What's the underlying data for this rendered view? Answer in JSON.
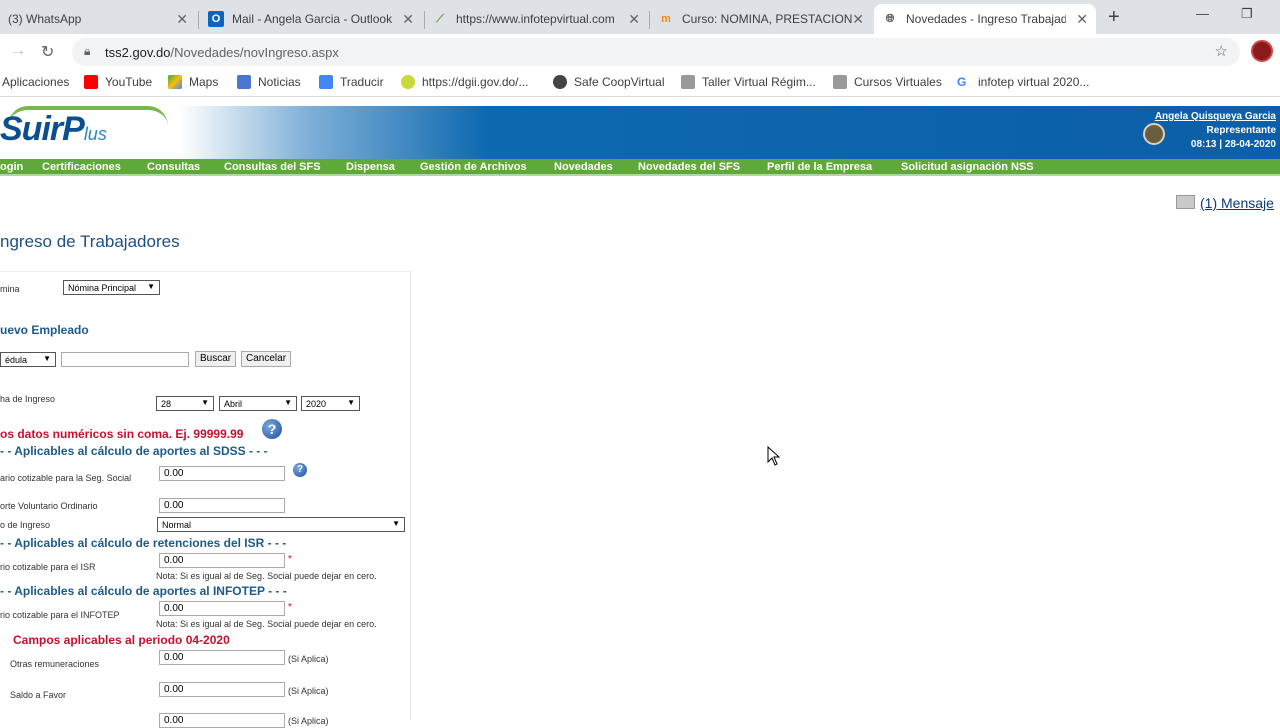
{
  "browser": {
    "tabs": [
      {
        "title": "(3) WhatsApp",
        "icon": "whatsapp-icon"
      },
      {
        "title": "Mail - Angela Garcia - Outlook",
        "icon": "outlook-icon"
      },
      {
        "title": "https://www.infotepvirtual.com",
        "icon": "infotep-icon"
      },
      {
        "title": "Curso: NOMINA, PRESTACIONE",
        "icon": "moodle-icon"
      },
      {
        "title": "Novedades - Ingreso Trabajad",
        "icon": "globe-icon"
      }
    ],
    "url_host": "tss2.gov.do",
    "url_path": "/Novedades/novIngreso.aspx",
    "bookmarks": [
      "Aplicaciones",
      "YouTube",
      "Maps",
      "Noticias",
      "Traducir",
      "https://dgii.gov.do/...",
      "Safe CoopVirtual",
      "Taller Virtual Régim...",
      "Cursos Virtuales",
      "infotep virtual 2020..."
    ]
  },
  "site": {
    "logo_main": "SuirP",
    "logo_tail": "lus",
    "user_name": "Angela Quisqueya Garcia",
    "user_role": "Representante",
    "user_time": "08:13 | 28-04-2020",
    "menu": [
      "ogin",
      "Certificaciones",
      "Consultas",
      "Consultas del SFS",
      "Dispensa",
      "Gestión de Archivos",
      "Novedades",
      "Novedades del SFS",
      "Perfil de la Empresa",
      "Solicitud asignación NSS"
    ],
    "messages_link": "(1) Mensaje"
  },
  "page": {
    "title": "ngreso de Trabajadores",
    "nomina_label": "mina",
    "nomina_value": "Nómina Principal",
    "new_employee_title": "uevo Empleado",
    "doc_type_value": "édula",
    "search_button": "Buscar",
    "cancel_button": "Cancelar",
    "fecha_label": "ha de Ingreso",
    "fecha_day": "28",
    "fecha_month": "Abril",
    "fecha_year": "2020",
    "numeric_warning": "os datos numéricos sin coma. Ej. 99999.99",
    "sdss_section": "- - Aplicables al cálculo de aportes al SDSS - - -",
    "salario_ss_label": "ario cotizable para la Seg. Social",
    "salario_ss_value": "0.00",
    "aporte_label": "orte Voluntario Ordinario",
    "aporte_value": "0.00",
    "tipo_ingreso_label": "o de Ingreso",
    "tipo_ingreso_value": "Normal",
    "isr_section": "- - Aplicables al cálculo de retenciones del ISR - - -",
    "salario_isr_label": "rio  cotizable para el ISR",
    "salario_isr_value": "0.00",
    "isr_note": "Nota: Si es igual al de Seg. Social puede dejar en cero.",
    "infotep_section": "- - Aplicables al cálculo de aportes al INFOTEP - - -",
    "salario_infotep_label": "rio  cotizable para el INFOTEP",
    "salario_infotep_value": "0.00",
    "infotep_note": "Nota: Si es igual al de Seg. Social puede dejar en cero.",
    "periodo_title": "Campos aplicables al periodo 04-2020",
    "otras_label": "Otras remuneraciones",
    "otras_value": "0.00",
    "otras_hint": "(Si Aplica)",
    "saldo_label": "Saldo a Favor",
    "saldo_value": "0.00",
    "saldo_hint": "(Si Aplica)",
    "extra_value": "0.00",
    "extra_hint": "(Si Aplica)",
    "asterisk": "*",
    "help_glyph": "?"
  }
}
